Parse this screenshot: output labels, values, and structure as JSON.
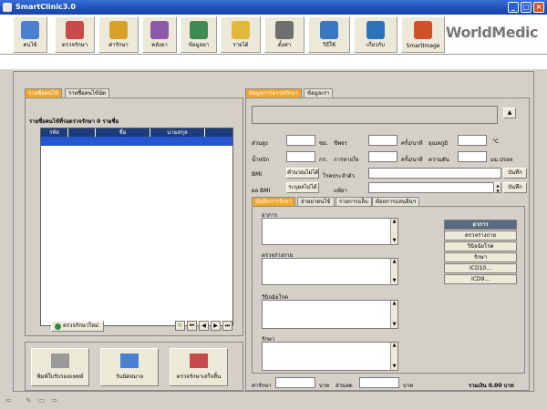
{
  "app": {
    "title": "SmartClinic3.0",
    "brand": "WorldMedic"
  },
  "toolbar": [
    {
      "label": "คนไข้",
      "icon": "patient-icon",
      "color": "#4a7fd0"
    },
    {
      "label": "ตรวจรักษา",
      "icon": "treatment-icon",
      "color": "#c74b4b"
    },
    {
      "label": "ค่ารักษา",
      "icon": "fee-icon",
      "color": "#d8a22a"
    },
    {
      "label": "คลังยา",
      "icon": "pharmacy-icon",
      "color": "#8c5aa8"
    },
    {
      "label": "ข้อมูลยา",
      "icon": "drug-info-icon",
      "color": "#3e8a52"
    },
    {
      "label": "รายได้",
      "icon": "income-icon",
      "color": "#e2b83a"
    },
    {
      "label": "ตั้งค่า",
      "icon": "settings-icon",
      "color": "#6f6f6f"
    },
    {
      "label": "วิธีใช้",
      "icon": "help-icon",
      "color": "#3a78c6"
    },
    {
      "label": "เกี่ยวกับ",
      "icon": "about-icon",
      "color": "#2d73b8"
    },
    {
      "label": "SmartImage",
      "icon": "smartimage-icon",
      "color": "#d0502a"
    }
  ],
  "left": {
    "tabs": [
      "รายชื่อคนไข้",
      "รายชื่อคนไข้นัด"
    ],
    "list_title": "รายชื่อคนไข้ที่รอตรวจรักษา 0 รายชื่อ",
    "columns": [
      "รหัส",
      "",
      "ชื่อ",
      "นามสกุล"
    ],
    "new_button": "ตรวจรักษาใหม่",
    "nav": [
      "↻",
      "⏮",
      "◀",
      "▶",
      "⏭"
    ],
    "big_buttons": [
      "พิมพ์ใบรับรองแพทย์",
      "วันนัดหมาย",
      "ตรวจรักษาเสร็จสิ้น"
    ]
  },
  "right": {
    "tabs": [
      "ข้อมูลการตรวจรักษา",
      "ข้อมูลเก่า"
    ],
    "vitals": {
      "height": "ส่วนสูง",
      "height_unit": "ซม.",
      "pulse": "ชีพจร",
      "pulse_unit": "ครั้ง/นาที",
      "temp": "อุณหภูมิ",
      "temp_unit": "°C",
      "weight": "น้ำหนัก",
      "weight_unit": "กก.",
      "resp": "การหายใจ",
      "resp_unit": "ครั้ง/นาที",
      "bp": "ความดัน",
      "bp_unit": "มม.ปรอท",
      "bmi": "BMI",
      "bmi_btn": "คำนวณไม่ได้",
      "bmi_result": "ผล BMI",
      "bmi_result_btn": "ระบุผลไม่ได้",
      "disease": "โรคประจำตัว",
      "allergy": "แพ้ยา",
      "save": "บันทึก"
    },
    "subtabs": [
      "บันทึกการรักษา",
      "จ่ายยาคนไข้",
      "รายการแล็บ",
      "ค้อยการแลนอินฯ"
    ],
    "fields": [
      "อาการ",
      "ตรวจร่างกาย",
      "วินิจฉัยโรค",
      "รักษา"
    ],
    "side_buttons": [
      "อาการ",
      "ตรวจร่างกาย",
      "วินิจฉัยโรค",
      "รักษา",
      "ICD10...",
      "ICD9..."
    ],
    "footer": {
      "fee": "ค่ารักษา",
      "baht1": "บาท",
      "discount": "ส่วนลด",
      "baht2": "บาท",
      "total": "รวมเงิน 0.00 บาท"
    }
  }
}
